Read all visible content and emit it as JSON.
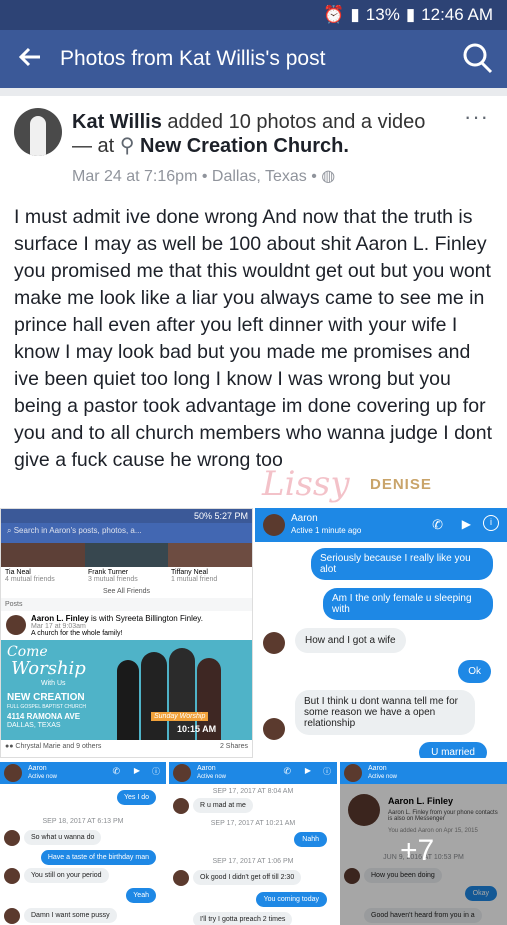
{
  "status_bar": {
    "battery": "13%",
    "time": "12:46 AM"
  },
  "app_bar": {
    "title": "Photos from Kat Willis's post"
  },
  "post": {
    "author": "Kat Willis",
    "action": "added 10 photos and a video",
    "at": "— at",
    "place": "New Creation Church",
    "time": "Mar 24 at 7:16pm",
    "location": "Dallas, Texas",
    "text": "I must admit ive done wrong And now that the truth is surface I may as well be 100 about shit Aaron L. Finley you promised me that this wouldnt get out but you wont make me look like a liar you always came to see me in prince hall even after you left dinner with your wife I know I may look bad but you made me promises and ive been quiet too long I know I was wrong but you being a pastor took advantage im done covering up for you and to all church members who wanna judge I dont give a fuck cause he wrong too"
  },
  "watermark": {
    "script": "Lissy",
    "word": "DENISE"
  },
  "photo1": {
    "status": "50% 5:27 PM",
    "search": "Search in Aaron's posts, photos, a...",
    "friends": [
      {
        "name": "Tia Neal",
        "mutual": "4 mutual friends"
      },
      {
        "name": "Frank Turner",
        "mutual": "3 mutual friends"
      },
      {
        "name": "Tiffany Neal",
        "mutual": "1 mutual friend"
      }
    ],
    "see_all": "See All Friends",
    "posts_label": "Posts",
    "poster": "Aaron L. Finley",
    "with": "is with Syreeta Billington Finley.",
    "post_time": "Mar 17 at 9:03am",
    "caption": "A church for the whole family!",
    "flyer_come": "Come",
    "flyer_worship": "Worship",
    "flyer_with": "With Us",
    "flyer_church": "NEW CREATION",
    "flyer_sub": "FULL GOSPEL BAPTIST CHURCH",
    "flyer_addr": "4114 RAMONA AVE",
    "flyer_city": "DALLAS, TEXAS",
    "flyer_sunday": "Sunday Worship",
    "flyer_time": "10:15 AM",
    "reactions": "Chrystal Marie and 9 others",
    "shares": "2 Shares"
  },
  "photo2": {
    "name": "Aaron",
    "status": "Active 1 minute ago",
    "msgs": [
      "Seriously because I really like you alot",
      "Am I the only female u sleeping with",
      "How and I got a wife",
      "Ok",
      "But I think u dont wanna tell me for some reason we have a open relationship",
      "U married"
    ]
  },
  "photo3": {
    "name": "Aaron",
    "status": "Active now",
    "msgs": [
      "Yes I do",
      "So what u wanna do",
      "Have a taste of the birthday man",
      "You still on your period",
      "Yeah",
      "Damn I want some pussy"
    ],
    "time": "SEP 18, 2017 AT 6:13 PM"
  },
  "photo4": {
    "name": "Aaron",
    "status": "Active now",
    "msgs": [
      "R u mad at me",
      "Nahh",
      "Ok good I didn't get off till 2:30",
      "You coming today",
      "I'll try I gotta preach 2 times"
    ],
    "times": [
      "SEP 17, 2017 AT 8:04 AM",
      "SEP 17, 2017 AT 10:21 AM",
      "SEP 17, 2017 AT 1:06 PM"
    ]
  },
  "photo5": {
    "name": "Aaron",
    "status": "Active now",
    "profile_name": "Aaron L. Finley",
    "profile_sub": "Aaron L. Finley from your phone contacts is also on Messenger",
    "added": "You added Aaron on Apr 15, 2015",
    "more": "+7",
    "msgs": [
      "How you been doing",
      "Okay",
      "Good haven't heard from you in a"
    ],
    "time": "JUN 9, 2016 AT 10:53 PM"
  },
  "colors": {
    "facebook_blue": "#3b5998",
    "messenger_blue": "#1e88e5"
  }
}
